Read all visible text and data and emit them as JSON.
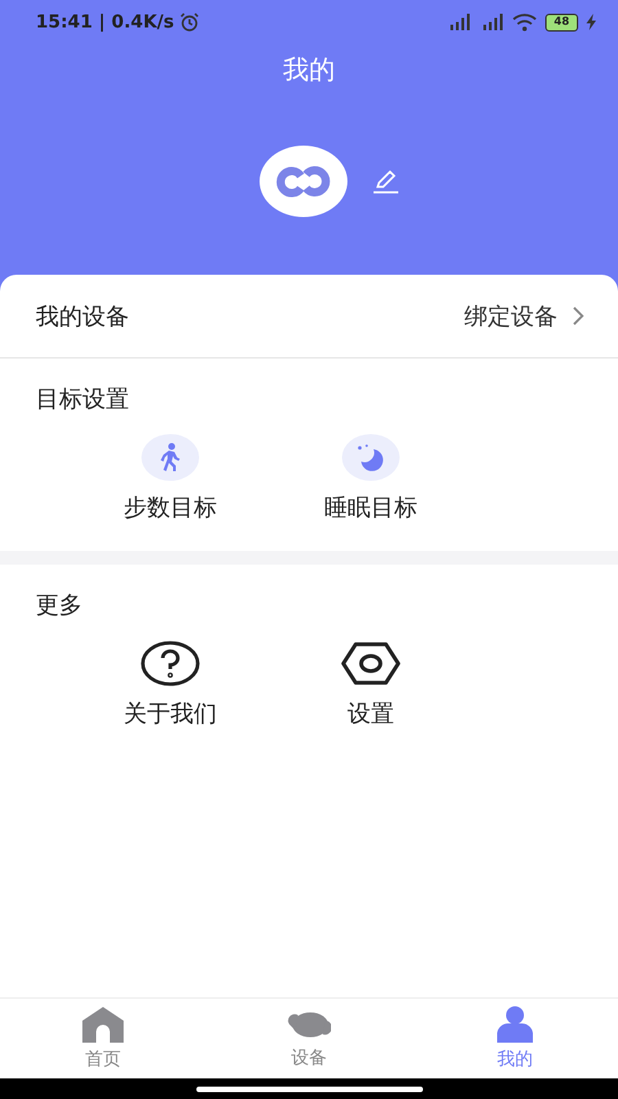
{
  "status_bar": {
    "time": "15:41 | 0.4K/s",
    "battery": "48"
  },
  "header": {
    "title": "我的"
  },
  "device_row": {
    "label": "我的设备",
    "action": "绑定设备"
  },
  "sections": [
    {
      "title": "目标设置",
      "items": [
        {
          "label": "步数目标"
        },
        {
          "label": "睡眠目标"
        }
      ]
    },
    {
      "title": "更多",
      "items": [
        {
          "label": "关于我们"
        },
        {
          "label": "设置"
        }
      ]
    }
  ],
  "tabs": [
    {
      "label": "首页",
      "selected": false
    },
    {
      "label": "设备",
      "selected": false
    },
    {
      "label": "我的",
      "selected": true
    }
  ]
}
